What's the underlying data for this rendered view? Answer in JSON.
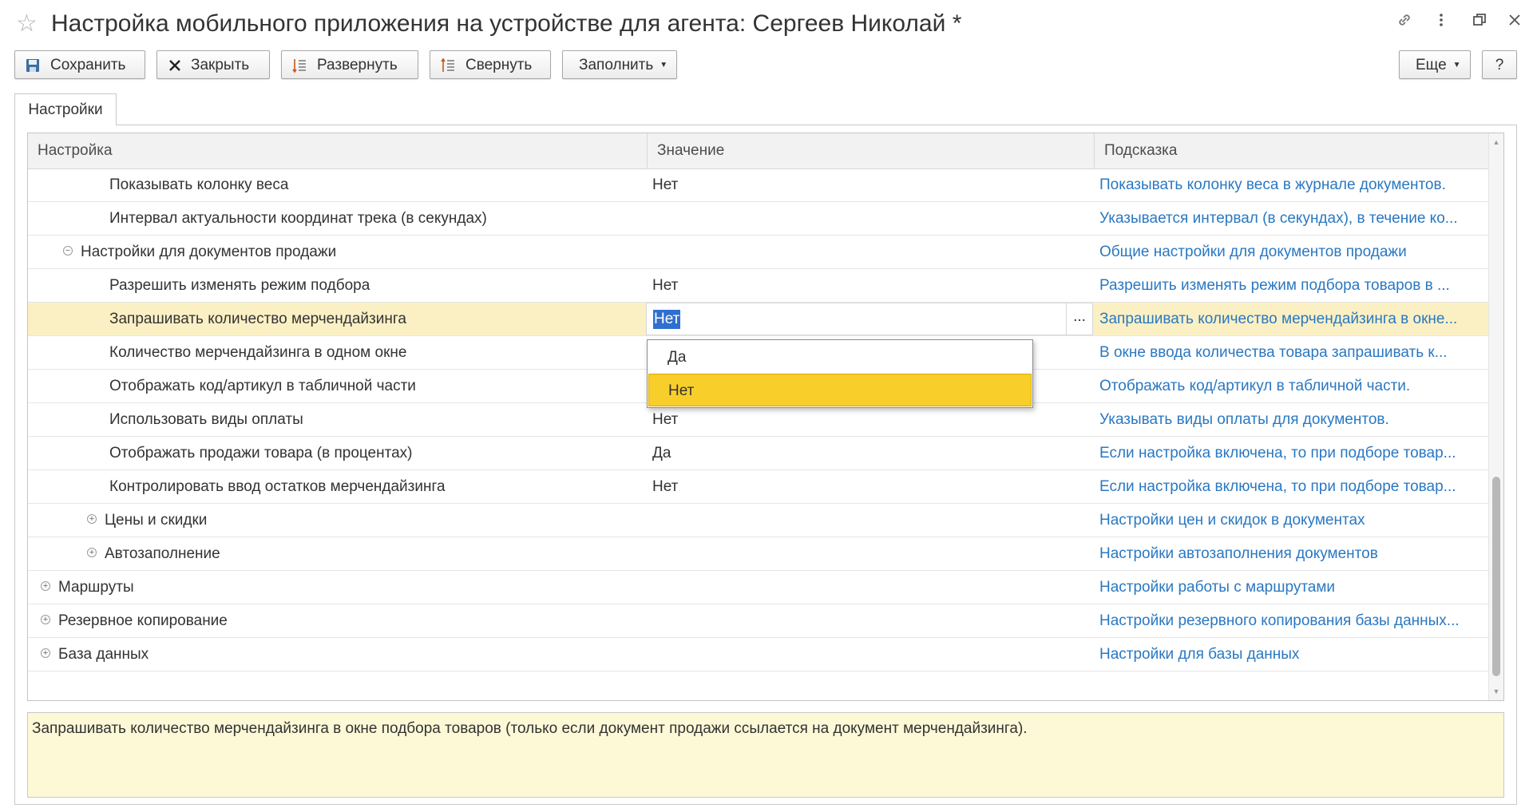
{
  "window": {
    "title": "Настройка мобильного приложения на устройстве для агента: Сергеев Николай *",
    "icons": [
      "star-icon",
      "link-icon",
      "more-vertical-icon",
      "restore-icon",
      "close-icon"
    ]
  },
  "toolbar": {
    "save_label": "Сохранить",
    "close_label": "Закрыть",
    "expand_label": "Развернуть",
    "collapse_label": "Свернуть",
    "fill_label": "Заполнить",
    "more_label": "Еще",
    "help_label": "?"
  },
  "tabs": [
    {
      "label": "Настройки"
    }
  ],
  "table": {
    "columns": [
      "Настройка",
      "Значение",
      "Подсказка"
    ],
    "rows": [
      {
        "name": "Показывать колонку веса",
        "value": "Нет",
        "hint": "Показывать колонку веса в журнале документов."
      },
      {
        "name": "Интервал актуальности координат трека (в секундах)",
        "value": "",
        "hint": "Указывается интервал (в секундах), в течение ко..."
      },
      {
        "name": "Настройки для документов продажи",
        "value": "",
        "hint": "Общие настройки для документов продажи"
      },
      {
        "name": "Разрешить изменять режим подбора",
        "value": "Нет",
        "hint": "Разрешить изменять режим подбора товаров в ..."
      },
      {
        "name": "Запрашивать количество мерчендайзинга",
        "value": "Нет",
        "hint": "Запрашивать количество мерчендайзинга в окне..."
      },
      {
        "name": "Количество мерчендайзинга в одном окне",
        "value": "",
        "hint": "В окне ввода количества товара запрашивать к..."
      },
      {
        "name": "Отображать код/артикул в табличной части",
        "value": "",
        "hint": "Отображать код/артикул в табличной части."
      },
      {
        "name": "Использовать виды оплаты",
        "value": "Нет",
        "hint": "Указывать виды оплаты для документов."
      },
      {
        "name": "Отображать продажи товара (в процентах)",
        "value": "Да",
        "hint": "Если настройка включена, то при подборе товар..."
      },
      {
        "name": "Контролировать ввод остатков мерчендайзинга",
        "value": "Нет",
        "hint": "Если настройка включена, то при подборе товар..."
      },
      {
        "name": "Цены и скидки",
        "value": "",
        "hint": "Настройки цен и скидок в документах"
      },
      {
        "name": "Автозаполнение",
        "value": "",
        "hint": "Настройки автозаполнения документов"
      },
      {
        "name": "Маршруты",
        "value": "",
        "hint": "Настройки работы с маршрутами"
      },
      {
        "name": "Резервное копирование",
        "value": "",
        "hint": "Настройки резервного копирования базы данных..."
      },
      {
        "name": "База данных",
        "value": "",
        "hint": "Настройки для базы данных"
      }
    ],
    "selected_row": "Запрашивать количество мерчендайзинга",
    "edit_value": "Нет",
    "edit_button": "..."
  },
  "dropdown": {
    "options": [
      "Да",
      "Нет"
    ],
    "selected": "Нет"
  },
  "hint_panel": {
    "text": "Запрашивать количество мерчендайзинга в окне подбора товаров (только если документ продажи ссылается на документ мерчендайзинга)."
  },
  "colors": {
    "selected_row": "#fbf0c4",
    "dropdown_active": "#f8cf2a",
    "hint_link": "#2a78c2",
    "hint_panel_bg": "#fdf8d6",
    "text_selection": "#2f6fd0"
  }
}
